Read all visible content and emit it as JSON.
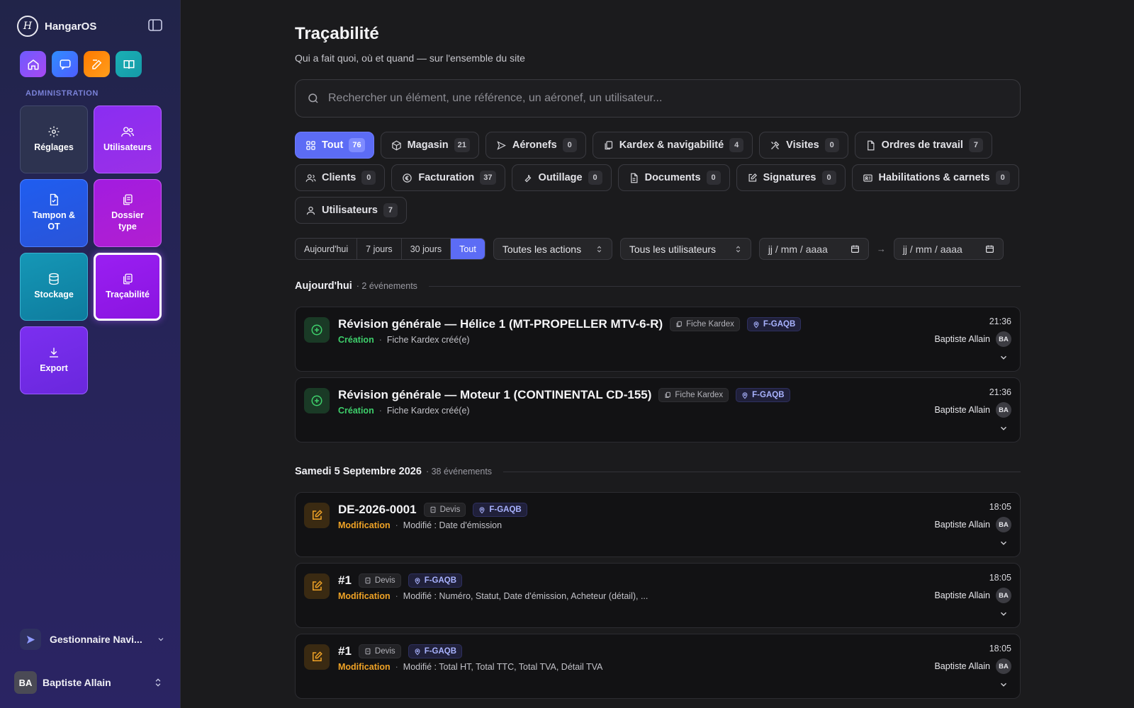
{
  "app": {
    "name": "HangarOS"
  },
  "sidebar": {
    "section_label": "ADMINISTRATION",
    "tiles": [
      {
        "label": "Réglages",
        "icon": "gear-icon"
      },
      {
        "label": "Utilisateurs",
        "icon": "users-icon"
      },
      {
        "label": "Tampon & OT",
        "icon": "stamp-document-icon"
      },
      {
        "label": "Dossier type",
        "icon": "folder-copy-icon"
      },
      {
        "label": "Stockage",
        "icon": "database-icon"
      },
      {
        "label": "Traçabilité",
        "icon": "trace-copy-icon"
      },
      {
        "label": "Export",
        "icon": "download-icon"
      }
    ],
    "quick_actions": [
      "home-icon",
      "chat-icon",
      "edit-icon",
      "book-icon"
    ],
    "role": "Gestionnaire Navi...",
    "user": {
      "initials": "BA",
      "name": "Baptiste Allain"
    }
  },
  "page": {
    "title": "Traçabilité",
    "subtitle": "Qui a fait quoi, où et quand — sur l'ensemble du site",
    "search_placeholder": "Rechercher un élément, une référence, un aéronef, un utilisateur..."
  },
  "filters": [
    {
      "label": "Tout",
      "count": "76",
      "active": true
    },
    {
      "label": "Magasin",
      "count": "21"
    },
    {
      "label": "Aéronefs",
      "count": "0"
    },
    {
      "label": "Kardex & navigabilité",
      "count": "4"
    },
    {
      "label": "Visites",
      "count": "0"
    },
    {
      "label": "Ordres de travail",
      "count": "7"
    },
    {
      "label": "Clients",
      "count": "0"
    },
    {
      "label": "Facturation",
      "count": "37"
    },
    {
      "label": "Outillage",
      "count": "0"
    },
    {
      "label": "Documents",
      "count": "0"
    },
    {
      "label": "Signatures",
      "count": "0"
    },
    {
      "label": "Habilitations & carnets",
      "count": "0"
    },
    {
      "label": "Utilisateurs",
      "count": "7"
    }
  ],
  "toolbar": {
    "periods": [
      "Aujourd'hui",
      "7 jours",
      "30 jours",
      "Tout"
    ],
    "active_period": "Tout",
    "actions_select": "Toutes les actions",
    "users_select": "Tous les utilisateurs",
    "date_from": "jj / mm / aaaa",
    "date_to": "jj / mm / aaaa"
  },
  "groups": [
    {
      "title": "Aujourd'hui",
      "count": "· 2 événements",
      "events": [
        {
          "title": "Révision générale — Hélice 1 (MT-PROPELLER MTV-6-R)",
          "kind": "Fiche Kardex",
          "aircraft": "F-GAQB",
          "action": "Création",
          "desc": "Fiche Kardex créé(e)",
          "time": "21:36",
          "user": "Baptiste Allain",
          "initials": "BA"
        },
        {
          "title": "Révision générale — Moteur 1 (CONTINENTAL CD-155)",
          "kind": "Fiche Kardex",
          "aircraft": "F-GAQB",
          "action": "Création",
          "desc": "Fiche Kardex créé(e)",
          "time": "21:36",
          "user": "Baptiste Allain",
          "initials": "BA"
        }
      ]
    },
    {
      "title": "Samedi 5 Septembre 2026",
      "count": "· 38 événements",
      "events": [
        {
          "title": "DE-2026-0001",
          "kind": "Devis",
          "aircraft": "F-GAQB",
          "action": "Modification",
          "desc": "Modifié : Date d'émission",
          "time": "18:05",
          "user": "Baptiste Allain",
          "initials": "BA"
        },
        {
          "title": "#1",
          "kind": "Devis",
          "aircraft": "F-GAQB",
          "action": "Modification",
          "desc": "Modifié : Numéro, Statut, Date d'émission, Acheteur (détail), ...",
          "time": "18:05",
          "user": "Baptiste Allain",
          "initials": "BA"
        },
        {
          "title": "#1",
          "kind": "Devis",
          "aircraft": "F-GAQB",
          "action": "Modification",
          "desc": "Modifié : Total HT, Total TTC, Total TVA, Détail TVA",
          "time": "18:05",
          "user": "Baptiste Allain",
          "initials": "BA"
        }
      ]
    }
  ],
  "colors": {
    "accent": "#5c6cf5",
    "create": "#3ecf6b",
    "modify": "#f0a326"
  }
}
